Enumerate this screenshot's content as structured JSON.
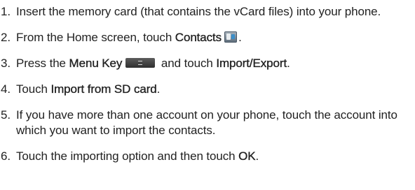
{
  "steps": [
    {
      "number": "1.",
      "text": "Insert the memory card (that contains the vCard files) into your phone."
    },
    {
      "number": "2.",
      "text_before": "From the Home screen, touch ",
      "bold": "Contacts",
      "icon": "contacts-app-icon",
      "text_after": "."
    },
    {
      "number": "3.",
      "text_before": "Press the ",
      "bold": "Menu Key",
      "icon": "menu-key-icon",
      "text_middle": " and touch ",
      "bold2": "Import/Export",
      "text_after": "."
    },
    {
      "number": "4.",
      "text_before": "Touch ",
      "bold": "Import from SD card",
      "text_after": "."
    },
    {
      "number": "5.",
      "text": "If you have more than one account on your phone, touch the account into which you want to import the contacts."
    },
    {
      "number": "6.",
      "text_before": "Touch the importing option and then touch ",
      "bold": "OK",
      "text_after": "."
    }
  ]
}
